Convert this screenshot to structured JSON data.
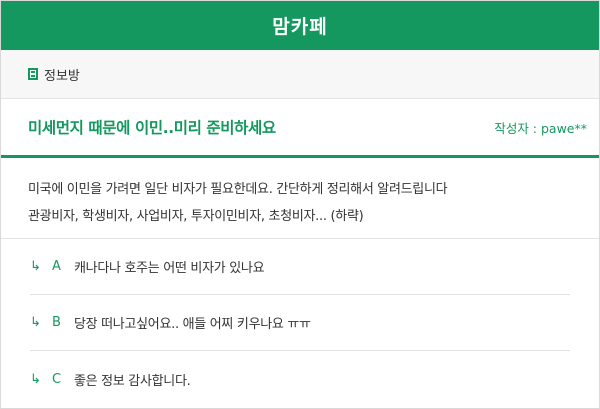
{
  "header": {
    "title": "맘카페"
  },
  "board": {
    "icon": "board-list-icon",
    "name": "정보방"
  },
  "post": {
    "title": "미세먼지 때문에 이민..미리 준비하세요",
    "author": "작성자 : pawe**",
    "body_lines": [
      "미국에 이민을 가려면 일단 비자가 필요한데요. 간단하게 정리해서 알려드립니다",
      "관광비자, 학생비자, 사업비자, 투자이민비자, 초청비자... (하략)"
    ]
  },
  "comments": [
    {
      "arrow": "↳",
      "letter": "A",
      "text": "캐나다나 호주는 어떤 비자가 있나요"
    },
    {
      "arrow": "↳",
      "letter": "B",
      "text": "당장 떠나고싶어요.. 애들 어찌 키우나요 ㅠㅠ"
    },
    {
      "arrow": "↳",
      "letter": "C",
      "text": "좋은 정보 감사합니다."
    }
  ],
  "colors": {
    "accent": "#14985f"
  }
}
